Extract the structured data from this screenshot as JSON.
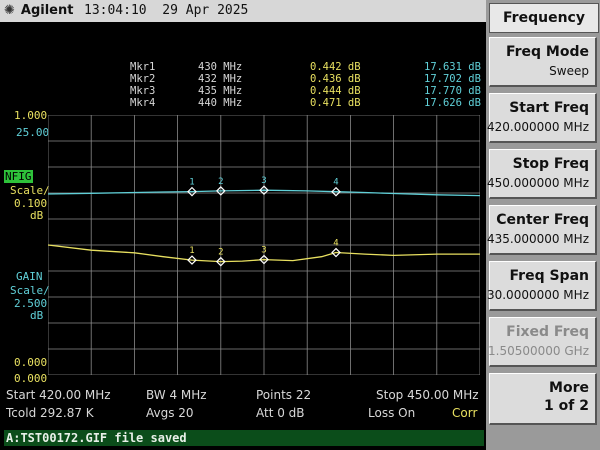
{
  "header": {
    "brand": "Agilent",
    "time": "13:04:10",
    "date": "29 Apr 2025"
  },
  "markers": [
    {
      "name": "Mkr1",
      "freq": "430 MHz",
      "nf": "0.442 dB",
      "gain": "17.631 dB"
    },
    {
      "name": "Mkr2",
      "freq": "432 MHz",
      "nf": "0.436 dB",
      "gain": "17.702 dB"
    },
    {
      "name": "Mkr3",
      "freq": "435 MHz",
      "nf": "0.444 dB",
      "gain": "17.770 dB"
    },
    {
      "name": "Mkr4",
      "freq": "440 MHz",
      "nf": "0.471 dB",
      "gain": "17.626 dB"
    }
  ],
  "nf_axis": {
    "top": "1.000",
    "ref": "25.00",
    "tag": "NFIG",
    "scale_label": "Scale/",
    "scale_value": "0.100",
    "unit": "dB",
    "bottom": "0.000"
  },
  "gain_axis": {
    "tag": "GAIN",
    "scale_label": "Scale/",
    "scale_value": "2.500",
    "unit": "dB",
    "bottom": "0.000"
  },
  "status": {
    "start": "Start 420.00 MHz",
    "bw": "BW 4 MHz",
    "points": "Points 22",
    "stop": "Stop 450.00 MHz",
    "tcold": "Tcold 292.87 K",
    "avgs": "Avgs 20",
    "att": "Att 0 dB",
    "loss": "Loss On",
    "corr": "Corr"
  },
  "command_line": "A:TST00172.GIF file saved",
  "softkeys": {
    "title": "Frequency",
    "keys": [
      {
        "label": "Freq Mode",
        "value": "Sweep"
      },
      {
        "label": "Start Freq",
        "value": "420.000000 MHz"
      },
      {
        "label": "Stop Freq",
        "value": "450.000000 MHz"
      },
      {
        "label": "Center Freq",
        "value": "435.000000 MHz"
      },
      {
        "label": "Freq Span",
        "value": "30.0000000 MHz"
      },
      {
        "label": "Fixed Freq",
        "value": "1.50500000 GHz"
      },
      {
        "label": "More",
        "value": "1 of 2"
      }
    ]
  },
  "chart_data": {
    "type": "line",
    "xlim": [
      420,
      450
    ],
    "x_unit": "MHz",
    "grid": true,
    "series": [
      {
        "name": "NFIG",
        "color": "#e8e060",
        "x": [
          420,
          423,
          426,
          428,
          430,
          432,
          433.5,
          435,
          437,
          439,
          440,
          442,
          444,
          447,
          450
        ],
        "values": [
          0.5,
          0.48,
          0.47,
          0.455,
          0.442,
          0.436,
          0.438,
          0.444,
          0.44,
          0.455,
          0.471,
          0.465,
          0.46,
          0.465,
          0.465
        ]
      },
      {
        "name": "GAIN",
        "color": "#60d0d8",
        "x": [
          420,
          423,
          426,
          428,
          430,
          432,
          435,
          438,
          440,
          442,
          444,
          447,
          450
        ],
        "values": [
          17.4,
          17.47,
          17.55,
          17.6,
          17.631,
          17.702,
          17.77,
          17.7,
          17.626,
          17.55,
          17.45,
          17.33,
          17.25
        ]
      }
    ],
    "markers": [
      {
        "id": "1",
        "x": 430
      },
      {
        "id": "2",
        "x": 432
      },
      {
        "id": "3",
        "x": 435
      },
      {
        "id": "4",
        "x": 440
      }
    ]
  }
}
